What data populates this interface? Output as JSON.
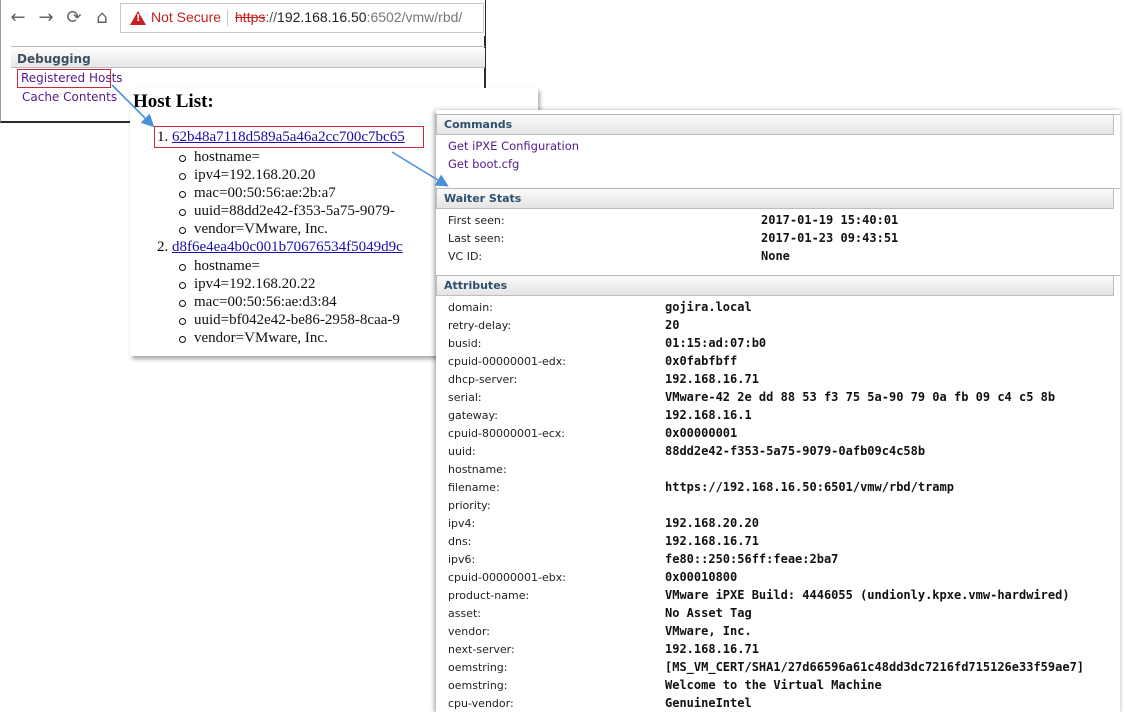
{
  "browser": {
    "nav": {
      "back": "←",
      "forward": "→",
      "reload": "⟳",
      "home": "⌂"
    },
    "security": {
      "warning_label": "Not Secure"
    },
    "url": {
      "scheme": "https",
      "separator": "://",
      "host": "192.168.16.50",
      "port": ":6502",
      "path": "/vmw/rbd/"
    }
  },
  "debugging": {
    "title": "Debugging",
    "links": [
      "Registered Hosts",
      "Cache Contents"
    ]
  },
  "host_list": {
    "title": "Host List:",
    "hosts": [
      {
        "number": "1.",
        "id": "62b48a7118d589a5a46a2cc700c7bc65",
        "attrs": [
          "hostname=",
          "ipv4=192.168.20.20",
          "mac=00:50:56:ae:2b:a7",
          "uuid=88dd2e42-f353-5a75-9079-",
          "vendor=VMware, Inc."
        ]
      },
      {
        "number": "2.",
        "id": "d8f6e4ea4b0c001b70676534f5049d9c",
        "attrs": [
          "hostname=",
          "ipv4=192.168.20.22",
          "mac=00:50:56:ae:d3:84",
          "uuid=bf042e42-be86-2958-8caa-9",
          "vendor=VMware, Inc."
        ]
      }
    ]
  },
  "detail": {
    "commands": {
      "title": "Commands",
      "links": [
        "Get iPXE Configuration",
        "Get boot.cfg"
      ]
    },
    "waiter_stats": {
      "title": "Waiter Stats",
      "rows": [
        {
          "label": "First seen:",
          "value": "2017-01-19 15:40:01"
        },
        {
          "label": "Last seen:",
          "value": "2017-01-23 09:43:51"
        },
        {
          "label": "VC ID:",
          "value": "None"
        }
      ]
    },
    "attributes": {
      "title": "Attributes",
      "rows": [
        {
          "label": "domain:",
          "value": "gojira.local"
        },
        {
          "label": "retry-delay:",
          "value": "20"
        },
        {
          "label": "busid:",
          "value": "01:15:ad:07:b0"
        },
        {
          "label": "cpuid-00000001-edx:",
          "value": "0x0fabfbff"
        },
        {
          "label": "dhcp-server:",
          "value": "192.168.16.71"
        },
        {
          "label": "serial:",
          "value": "VMware-42 2e dd 88 53 f3 75 5a-90 79 0a fb 09 c4 c5 8b"
        },
        {
          "label": "gateway:",
          "value": "192.168.16.1"
        },
        {
          "label": "cpuid-80000001-ecx:",
          "value": "0x00000001"
        },
        {
          "label": "uuid:",
          "value": "88dd2e42-f353-5a75-9079-0afb09c4c58b"
        },
        {
          "label": "hostname:",
          "value": ""
        },
        {
          "label": "filename:",
          "value": "https://192.168.16.50:6501/vmw/rbd/tramp"
        },
        {
          "label": "priority:",
          "value": ""
        },
        {
          "label": "ipv4:",
          "value": "192.168.20.20"
        },
        {
          "label": "dns:",
          "value": "192.168.16.71"
        },
        {
          "label": "ipv6:",
          "value": "fe80::250:56ff:feae:2ba7"
        },
        {
          "label": "cpuid-00000001-ebx:",
          "value": "0x00010800"
        },
        {
          "label": "product-name:",
          "value": "VMware iPXE Build: 4446055 (undionly.kpxe.vmw-hardwired)"
        },
        {
          "label": "asset:",
          "value": "No Asset Tag"
        },
        {
          "label": "vendor:",
          "value": "VMware, Inc."
        },
        {
          "label": "next-server:",
          "value": "192.168.16.71"
        },
        {
          "label": "oemstring:",
          "value": "[MS_VM_CERT/SHA1/27d66596a61c48dd3dc7216fd715126e33f59ae7]"
        },
        {
          "label": "oemstring:",
          "value": "Welcome to the Virtual Machine"
        },
        {
          "label": "cpu-vendor:",
          "value": "GenuineIntel"
        }
      ]
    }
  },
  "colors": {
    "highlight": "#d0283a",
    "arrow": "#4a90d9",
    "visited_link": "#551a8b",
    "link": "#1a0dab",
    "warning": "#c5221f"
  }
}
